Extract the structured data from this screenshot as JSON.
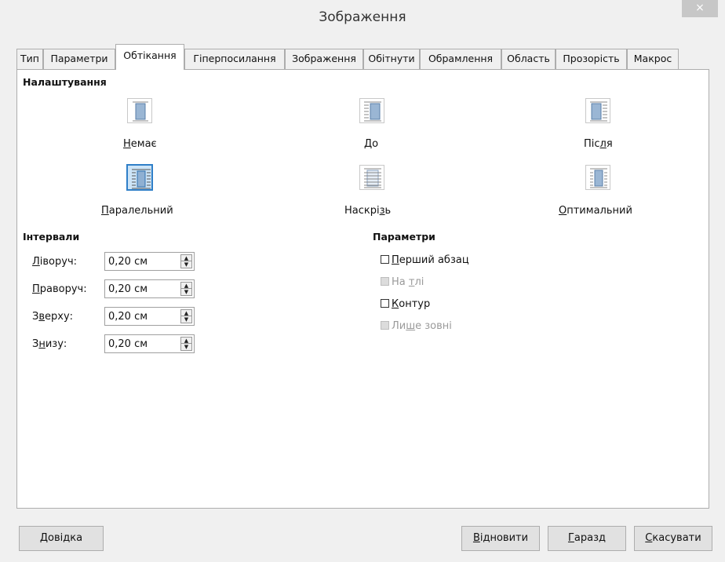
{
  "window": {
    "title": "Зображення",
    "close_icon": "×"
  },
  "tabs": [
    "Тип",
    "Параметри",
    "Обтікання",
    "Гіперпосилання",
    "Зображення",
    "Обітнути",
    "Обрамлення",
    "Область",
    "Прозорість",
    "Макрос"
  ],
  "active_tab": "Обтікання",
  "settings": {
    "heading": "Налаштування",
    "wrap_options": [
      {
        "pre": "",
        "ul": "Н",
        "post": "емає",
        "icon": "wrap-none-icon"
      },
      {
        "pre": "",
        "ul": "Д",
        "post": "о",
        "icon": "wrap-before-icon"
      },
      {
        "pre": "Піс",
        "ul": "л",
        "post": "я",
        "icon": "wrap-after-icon"
      },
      {
        "pre": "",
        "ul": "П",
        "post": "аралельний",
        "icon": "wrap-parallel-icon"
      },
      {
        "pre": "Наскрі",
        "ul": "з",
        "post": "ь",
        "icon": "wrap-through-icon"
      },
      {
        "pre": "",
        "ul": "О",
        "post": "птимальний",
        "icon": "wrap-optimal-icon"
      }
    ],
    "selected_option": "Паралельний"
  },
  "spacing": {
    "heading": "Інтервали",
    "rows": [
      {
        "pre": "",
        "ul": "Л",
        "post": "іворуч:",
        "value": "0,20 см"
      },
      {
        "pre": "",
        "ul": "П",
        "post": "раворуч:",
        "value": "0,20 см"
      },
      {
        "pre": "З",
        "ul": "в",
        "post": "ерху:",
        "value": "0,20 см"
      },
      {
        "pre": "З",
        "ul": "н",
        "post": "изу:",
        "value": "0,20 см"
      }
    ]
  },
  "options": {
    "heading": "Параметри",
    "items": [
      {
        "pre": "",
        "ul": "П",
        "post": "ерший абзац",
        "checked": false,
        "enabled": true
      },
      {
        "pre": "На ",
        "ul": "т",
        "post": "лі",
        "checked": false,
        "enabled": false
      },
      {
        "pre": "",
        "ul": "К",
        "post": "онтур",
        "checked": false,
        "enabled": true
      },
      {
        "pre": "Ли",
        "ul": "ш",
        "post": "е зовні",
        "checked": false,
        "enabled": false
      }
    ]
  },
  "buttons": {
    "help": {
      "pre": "",
      "ul": "Д",
      "post": "овідка"
    },
    "reset": {
      "pre": "",
      "ul": "В",
      "post": "ідновити"
    },
    "ok": {
      "pre": "",
      "ul": "Г",
      "post": "аразд"
    },
    "cancel": {
      "pre": "",
      "ul": "С",
      "post": "касувати"
    }
  }
}
